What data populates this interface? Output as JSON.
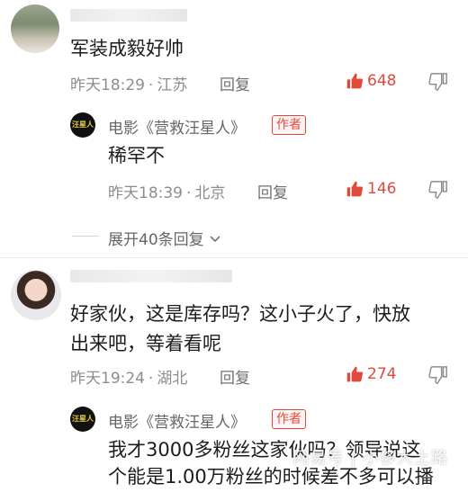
{
  "comments": [
    {
      "text": "军装成毅好帅",
      "time": "昨天18:29",
      "location": "江苏",
      "reply_label": "回复",
      "likes": "648",
      "replies": [
        {
          "author": "电影《营救汪星人》",
          "badge": "作者",
          "avatar_text": "汪星人",
          "text": "稀罕不",
          "time": "昨天18:39",
          "location": "北京",
          "reply_label": "回复",
          "likes": "146"
        }
      ],
      "expand_label": "展开40条回复"
    },
    {
      "text_line1": "好家伙，这是库存吗？这小子火了，快放",
      "text_line2": "出来吧，等着看呢",
      "time": "昨天19:24",
      "location": "湖北",
      "reply_label": "回复",
      "likes": "274",
      "replies": [
        {
          "author": "电影《营救汪星人》",
          "badge": "作者",
          "avatar_text": "汪星人",
          "text_line1": "我才3000多粉丝这家伙吗？领导说这",
          "text_line2": "个能是1.00万粉丝的时候差不多可以播"
        }
      ]
    }
  ],
  "separator": "·",
  "watermark": "网易号 | 小侈大土路",
  "icons": {
    "like": "thumbs-up-icon",
    "dislike": "thumbs-down-icon",
    "expand": "chevron-down-icon"
  },
  "colors": {
    "like": "#e14a3a",
    "badge": "#e14a3a",
    "meta": "#8d8d8d"
  }
}
